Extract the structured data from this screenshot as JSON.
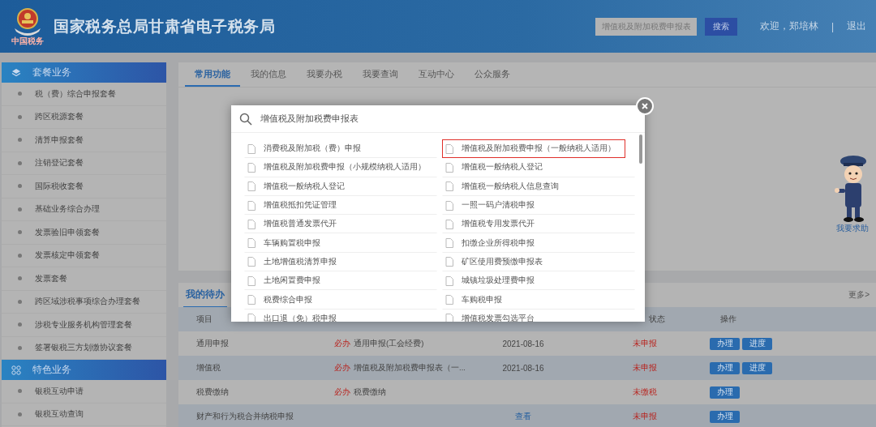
{
  "header": {
    "logo_caption": "中国税务",
    "title": "国家税务总局甘肃省电子税务局",
    "search": {
      "value": "增值税及附加税费申报表",
      "button": "搜索"
    },
    "welcome": "欢迎，郑培林",
    "separator": "|",
    "logout": "退出"
  },
  "sidebar": {
    "sections": [
      {
        "title": "套餐业务",
        "items": [
          "税（费）综合申报套餐",
          "跨区税源套餐",
          "清算申报套餐",
          "注销登记套餐",
          "国际税收套餐",
          "基础业务综合办理",
          "发票验旧申领套餐",
          "发票核定申领套餐",
          "发票套餐",
          "跨区域涉税事项综合办理套餐",
          "涉税专业服务机构管理套餐",
          "签署银税三方划缴协议套餐"
        ]
      },
      {
        "title": "特色业务",
        "items": [
          "银税互动申请",
          "银税互动查询"
        ]
      }
    ]
  },
  "tabs_panel": {
    "tabs": [
      {
        "label": "常用功能",
        "selected": true
      },
      {
        "label": "我的信息",
        "selected": false
      },
      {
        "label": "我要办税",
        "selected": false
      },
      {
        "label": "我要查询",
        "selected": false
      },
      {
        "label": "互动中心",
        "selected": false
      },
      {
        "label": "公众服务",
        "selected": false
      }
    ],
    "help_label": "我要求助"
  },
  "todo": {
    "title": "我的待办",
    "more": "更多>",
    "header": {
      "item": "项目",
      "status": "状态",
      "action": "操作"
    },
    "rows": [
      {
        "item": "通用申报",
        "tag": "必办",
        "matter": "通用申报(工会经费)",
        "date": "2021-08-16",
        "status": "未申报",
        "actions": [
          "办理",
          "进度"
        ]
      },
      {
        "item": "增值税",
        "tag": "必办",
        "matter": "增值税及附加税费申报表（一...",
        "date": "2021-08-16",
        "status": "未申报",
        "actions": [
          "办理",
          "进度"
        ]
      },
      {
        "item": "税费缴纳",
        "tag": "必办",
        "matter": "税费缴纳",
        "status": "未缴税",
        "actions": [
          "办理"
        ]
      },
      {
        "item": "财产和行为税合并纳税申报",
        "link": "查看",
        "status": "未申报",
        "actions": [
          "办理"
        ]
      }
    ]
  },
  "modal": {
    "query": "增值税及附加税费申报表",
    "columns": [
      [
        {
          "label": "消费税及附加税（费）申报",
          "highlighted": false
        },
        {
          "label": "增值税及附加税费申报（小规模纳税人适用）",
          "highlighted": false
        },
        {
          "label": "增值税一般纳税人登记",
          "highlighted": false
        },
        {
          "label": "增值税抵扣凭证管理",
          "highlighted": false
        },
        {
          "label": "增值税普通发票代开",
          "highlighted": false
        },
        {
          "label": "车辆购置税申报",
          "highlighted": false
        },
        {
          "label": "土地增值税清算申报",
          "highlighted": false
        },
        {
          "label": "土地闲置费申报",
          "highlighted": false
        },
        {
          "label": "税费综合申报",
          "highlighted": false
        },
        {
          "label": "出口退（免）税申报",
          "highlighted": false
        }
      ],
      [
        {
          "label": "增值税及附加税费申报（一般纳税人适用）",
          "highlighted": true
        },
        {
          "label": "增值税一般纳税人登记",
          "highlighted": false
        },
        {
          "label": "增值税一般纳税人信息查询",
          "highlighted": false
        },
        {
          "label": "一照一码户清税申报",
          "highlighted": false
        },
        {
          "label": "增值税专用发票代开",
          "highlighted": false
        },
        {
          "label": "扣缴企业所得税申报",
          "highlighted": false
        },
        {
          "label": "矿区使用费预缴申报表",
          "highlighted": false
        },
        {
          "label": "城镇垃圾处理费申报",
          "highlighted": false
        },
        {
          "label": "车购税申报",
          "highlighted": false
        },
        {
          "label": "增值税发票勾选平台",
          "highlighted": false
        }
      ]
    ]
  }
}
